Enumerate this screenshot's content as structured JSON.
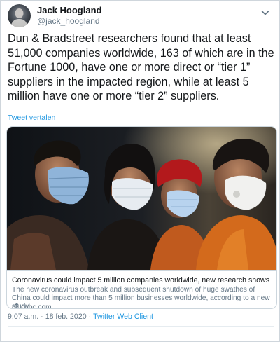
{
  "author": {
    "name": "Jack Hoogland",
    "handle": "@jack_hoogland"
  },
  "tweet": {
    "text": "Dun & Bradstreet researchers found that at least 51,000 companies worldwide, 163 of which are in the Fortune 1000, have one or more direct or “tier 1” suppliers in the impacted region, while at least 5 million have one or more “tier 2” suppliers.",
    "translate_label": "Tweet vertalen"
  },
  "card": {
    "title": "Coronavirus could impact 5 million companies worldwide, new research shows",
    "description": "The new coronavirus outbreak and subsequent shutdown of huge swathes of China could impact more than 5 million businesses worldwide, according to a new study.",
    "domain": "cnbc.com"
  },
  "meta": {
    "time": "9:07 a.m.",
    "separator": "·",
    "date": "18 feb. 2020",
    "separator2": "·",
    "client": "Twitter Web Client"
  },
  "icons": {
    "menu": "chevron-down-icon",
    "link": "link-icon"
  },
  "colors": {
    "link": "#1b95e0",
    "secondary_text": "#657786",
    "primary_text": "#14171a",
    "card_border": "#ccd6dd"
  }
}
